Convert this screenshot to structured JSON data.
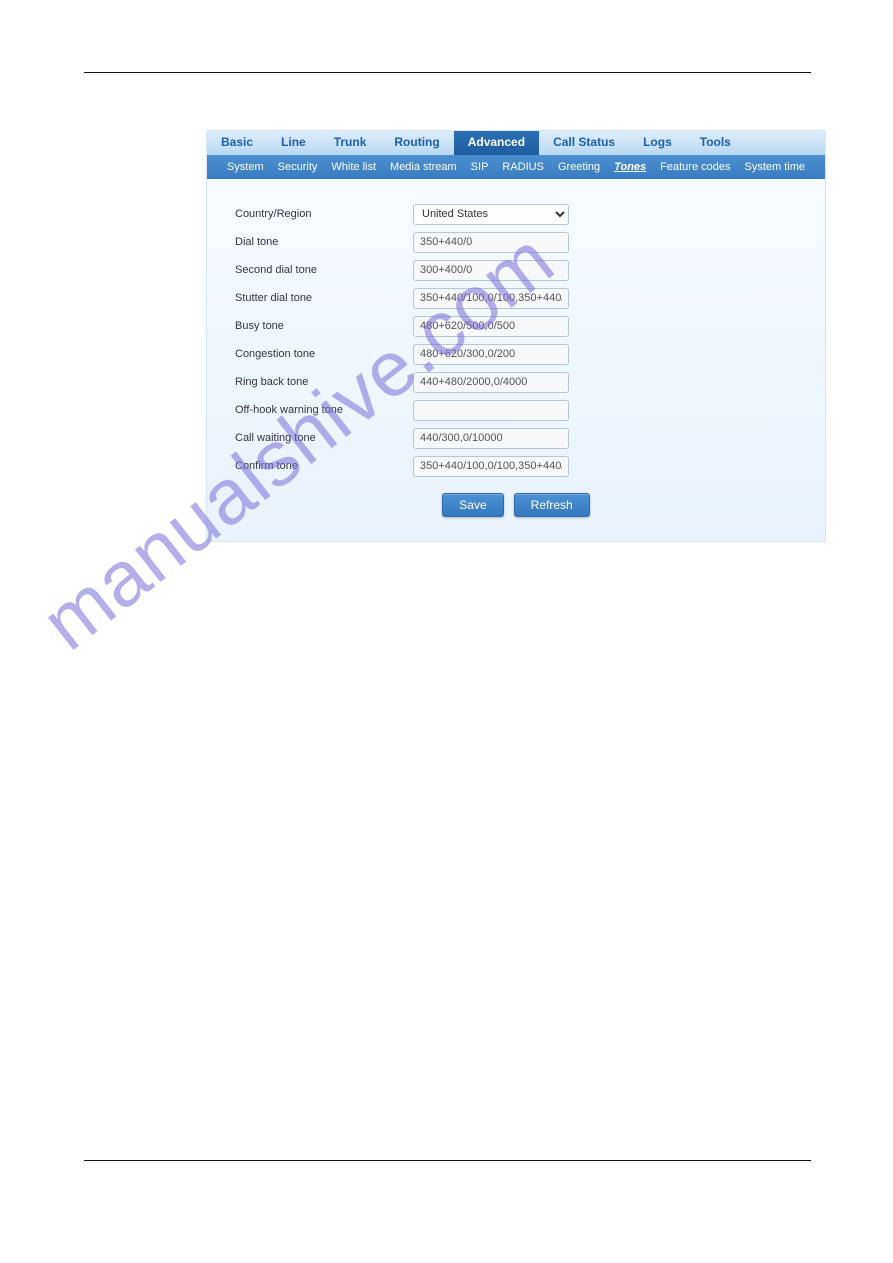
{
  "main_tabs": {
    "items": [
      "Basic",
      "Line",
      "Trunk",
      "Routing",
      "Advanced",
      "Call Status",
      "Logs",
      "Tools"
    ],
    "active_index": 4
  },
  "sub_tabs": {
    "items": [
      "System",
      "Security",
      "White list",
      "Media stream",
      "SIP",
      "RADIUS",
      "Greeting",
      "Tones",
      "Feature codes",
      "System time"
    ],
    "active_index": 7
  },
  "form": {
    "country_region": {
      "label": "Country/Region",
      "value": "United States"
    },
    "dial_tone": {
      "label": "Dial tone",
      "value": "350+440/0"
    },
    "second_dial_tone": {
      "label": "Second dial tone",
      "value": "300+400/0"
    },
    "stutter_dial_tone": {
      "label": "Stutter dial tone",
      "value": "350+440/100,0/100,350+440/100,"
    },
    "busy_tone": {
      "label": "Busy tone",
      "value": "480+620/500,0/500"
    },
    "congestion_tone": {
      "label": "Congestion tone",
      "value": "480+620/300,0/200"
    },
    "ring_back_tone": {
      "label": "Ring back tone",
      "value": "440+480/2000,0/4000"
    },
    "off_hook_warning_tone": {
      "label": "Off-hook warning tone",
      "value": ""
    },
    "call_waiting_tone": {
      "label": "Call waiting tone",
      "value": "440/300,0/10000"
    },
    "confirm_tone": {
      "label": "Confirm tone",
      "value": "350+440/100,0/100,350+440/100,"
    }
  },
  "buttons": {
    "save": "Save",
    "refresh": "Refresh"
  },
  "watermark": "manualshive.com"
}
